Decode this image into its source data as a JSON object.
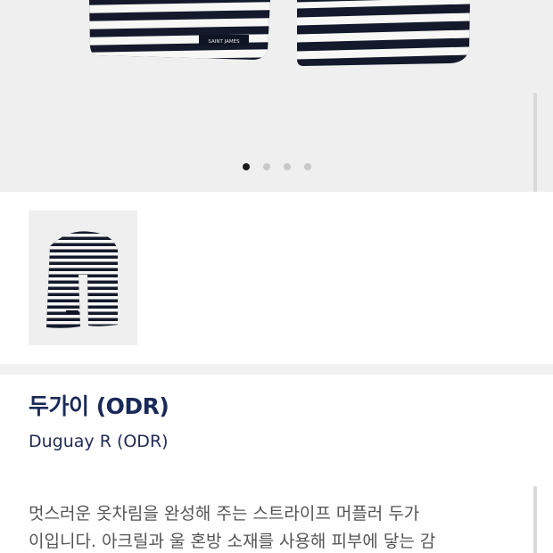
{
  "hero": {
    "label_text": "SAINT JAMES",
    "carousel": {
      "total": 4,
      "active_index": 0
    }
  },
  "thumbnail": {
    "alt": "striped scarf"
  },
  "product": {
    "title": "두가이 (ODR)",
    "subtitle": "Duguay R (ODR)",
    "description_lines": [
      "멋스러운 옷차림을 완성해 주는 스트라이프 머플러 두가",
      "이입니다. 아크릴과 울 혼방 소재를 사용해 피부에 닿는 감"
    ]
  },
  "colors": {
    "navy_stripe": "#141a2c",
    "title_navy": "#1a2a58",
    "background_gray": "#efefef"
  }
}
